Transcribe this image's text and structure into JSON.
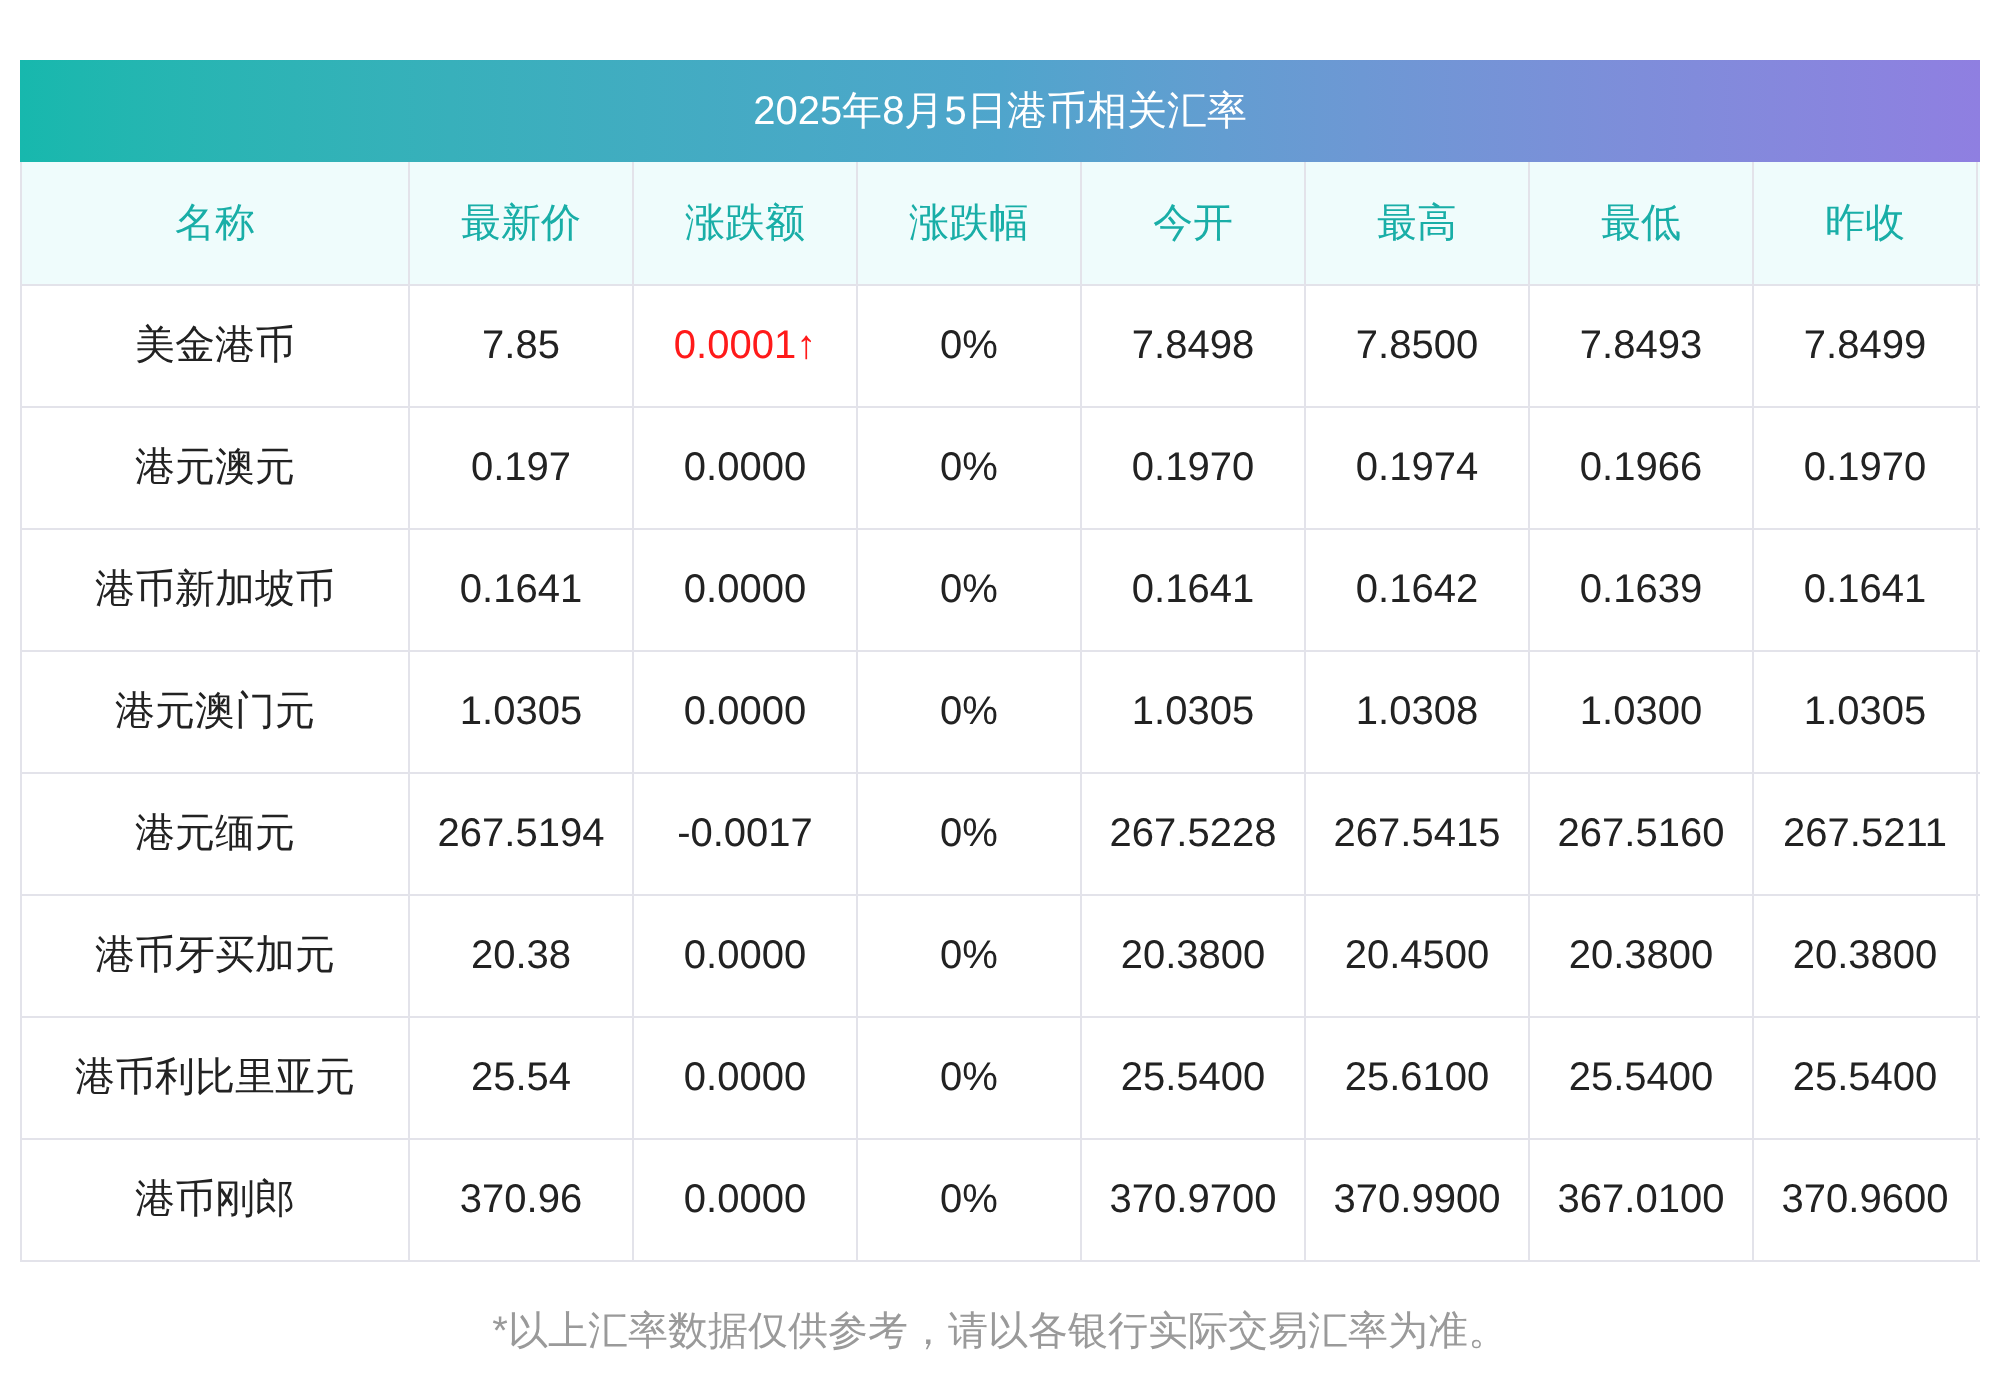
{
  "title": "2025年8月5日港币相关汇率",
  "columns": [
    "名称",
    "最新价",
    "涨跌额",
    "涨跌幅",
    "今开",
    "最高",
    "最低",
    "昨收"
  ],
  "rows": [
    {
      "cells": [
        "美金港币",
        "7.85",
        "0.0001↑",
        "0%",
        "7.8498",
        "7.8500",
        "7.8493",
        "7.8499"
      ],
      "rising": true
    },
    {
      "cells": [
        "港元澳元",
        "0.197",
        "0.0000",
        "0%",
        "0.1970",
        "0.1974",
        "0.1966",
        "0.1970"
      ],
      "rising": false
    },
    {
      "cells": [
        "港币新加坡币",
        "0.1641",
        "0.0000",
        "0%",
        "0.1641",
        "0.1642",
        "0.1639",
        "0.1641"
      ],
      "rising": false
    },
    {
      "cells": [
        "港元澳门元",
        "1.0305",
        "0.0000",
        "0%",
        "1.0305",
        "1.0308",
        "1.0300",
        "1.0305"
      ],
      "rising": false
    },
    {
      "cells": [
        "港元缅元",
        "267.5194",
        "-0.0017",
        "0%",
        "267.5228",
        "267.5415",
        "267.5160",
        "267.5211"
      ],
      "rising": false
    },
    {
      "cells": [
        "港币牙买加元",
        "20.38",
        "0.0000",
        "0%",
        "20.3800",
        "20.4500",
        "20.3800",
        "20.3800"
      ],
      "rising": false
    },
    {
      "cells": [
        "港币利比里亚元",
        "25.54",
        "0.0000",
        "0%",
        "25.5400",
        "25.6100",
        "25.5400",
        "25.5400"
      ],
      "rising": false
    },
    {
      "cells": [
        "港币刚郎",
        "370.96",
        "0.0000",
        "0%",
        "370.9700",
        "370.9900",
        "367.0100",
        "370.9600"
      ],
      "rising": false
    }
  ],
  "footnote": "*以上汇率数据仅供参考，请以各银行实际交易汇率为准。"
}
